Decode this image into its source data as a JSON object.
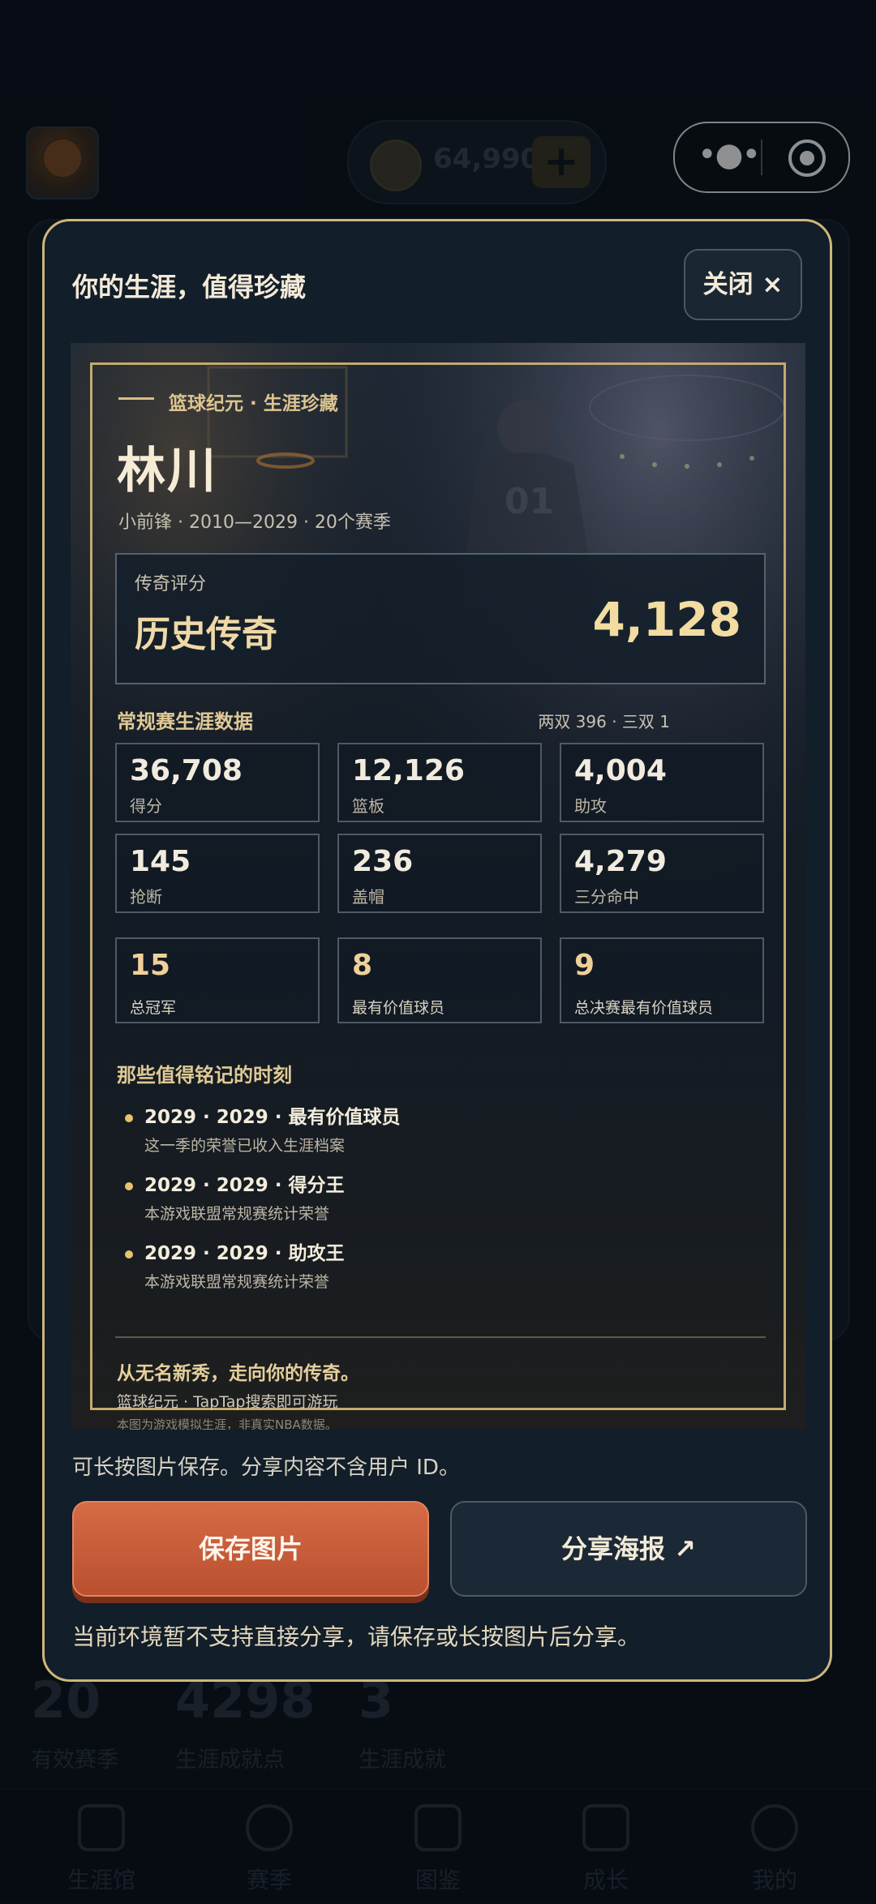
{
  "topbar": {
    "coins": "64,990",
    "plus_label": "+"
  },
  "background_stats": [
    {
      "value": "20",
      "label": "有效赛季"
    },
    {
      "value": "4298",
      "label": "生涯成就点"
    },
    {
      "value": "3",
      "label": "生涯成就"
    }
  ],
  "tabbar": [
    {
      "label": "生涯馆",
      "icon": "home-icon"
    },
    {
      "label": "赛季",
      "icon": "basketball-icon"
    },
    {
      "label": "图鉴",
      "icon": "book-icon"
    },
    {
      "label": "成长",
      "icon": "bar-chart-icon"
    },
    {
      "label": "我的",
      "icon": "user-icon"
    }
  ],
  "modal": {
    "title": "你的生涯，值得珍藏",
    "close_label": "关闭 ×",
    "hint": "可长按图片保存。分享内容不含用户 ID。",
    "save_label": "保存图片",
    "share_label": "分享海报 ↗",
    "note": "当前环境暂不支持直接分享，请保存或长按图片后分享。"
  },
  "poster": {
    "eyebrow": "篮球纪元 · 生涯珍藏",
    "name": "林川",
    "meta": "小前锋  ·  2010—2029  ·  20个赛季",
    "jersey_number": "01",
    "score_label": "传奇评分",
    "score_title": "历史传奇",
    "score_value": "4,128",
    "section_title": "常规赛生涯数据",
    "section_sub": "两双 396 · 三双 1",
    "stats": [
      {
        "value": "36,708",
        "label": "得分"
      },
      {
        "value": "12,126",
        "label": "篮板"
      },
      {
        "value": "4,004",
        "label": "助攻"
      },
      {
        "value": "145",
        "label": "抢断"
      },
      {
        "value": "236",
        "label": "盖帽"
      },
      {
        "value": "4,279",
        "label": "三分命中"
      }
    ],
    "honors": [
      {
        "value": "15",
        "label": "总冠军"
      },
      {
        "value": "8",
        "label": "最有价值球员"
      },
      {
        "value": "9",
        "label": "总决赛最有价值球员"
      }
    ],
    "moments_title": "那些值得铭记的时刻",
    "moments": [
      {
        "title": "2029 · 2029 · 最有价值球员",
        "sub": "这一季的荣誉已收入生涯档案"
      },
      {
        "title": "2029 · 2029 · 得分王",
        "sub": "本游戏联盟常规赛统计荣誉"
      },
      {
        "title": "2029 · 2029 · 助攻王",
        "sub": "本游戏联盟常规赛统计荣誉"
      }
    ],
    "slogan": "从无名新秀，走向你的传奇。",
    "promo": "篮球纪元 · TapTap搜索即可游玩",
    "disclaimer": "本图为游戏模拟生涯，非真实NBA数据。"
  }
}
